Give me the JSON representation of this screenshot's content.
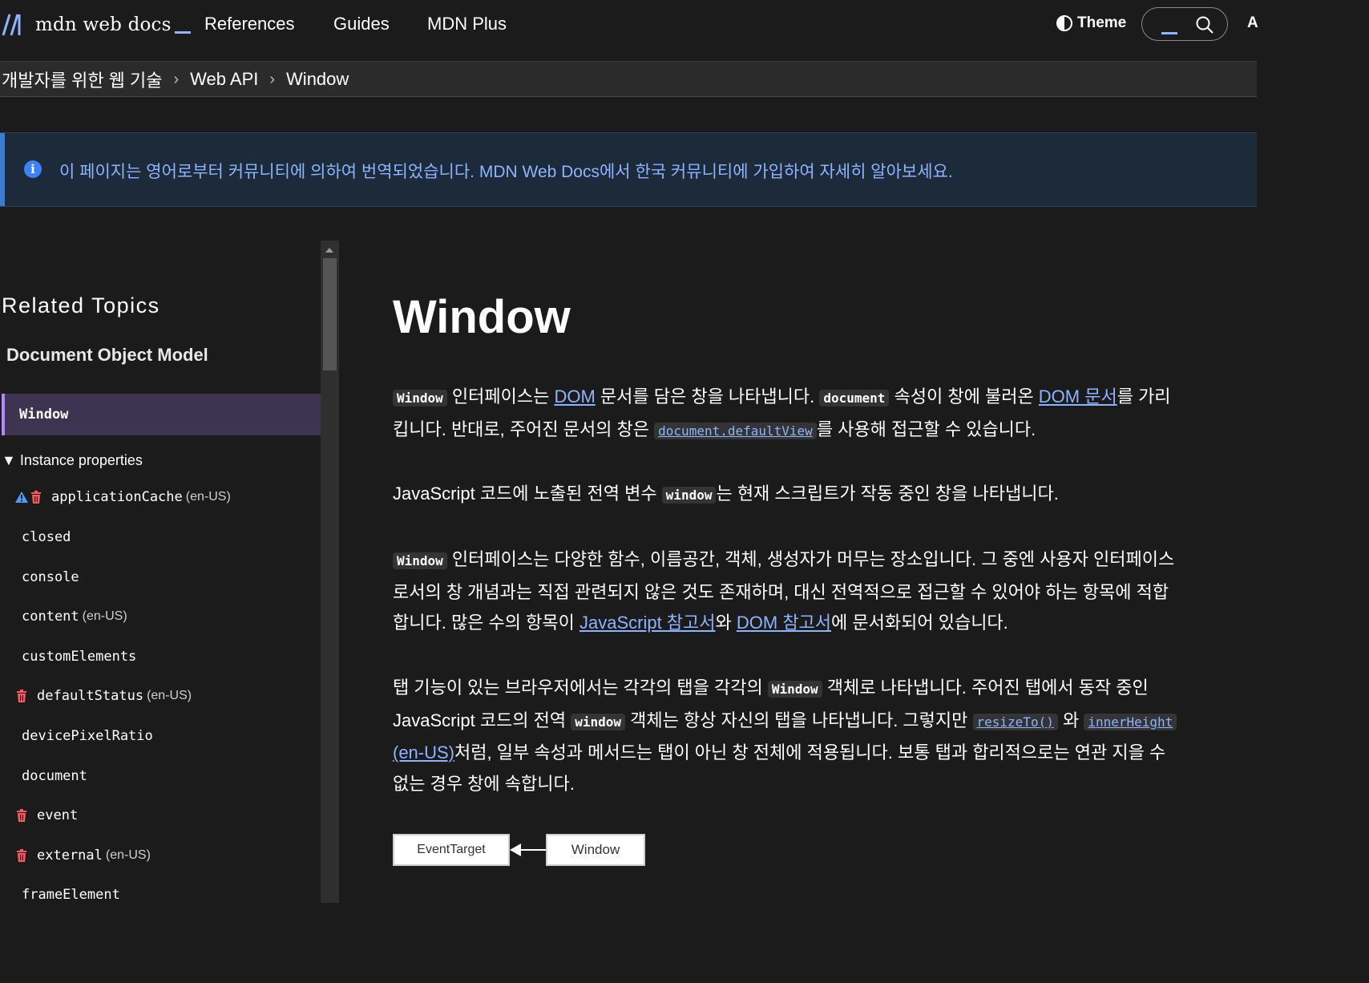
{
  "header": {
    "logo_text": "mdn web docs",
    "nav": [
      "References",
      "Guides",
      "MDN Plus"
    ],
    "theme_label": "Theme",
    "cut_text": "A"
  },
  "breadcrumb": [
    "개발자를 위한 웹 기술",
    "Web API",
    "Window"
  ],
  "notice": {
    "text": "이 페이지는 영어로부터 커뮤니티에 의하여 번역되었습니다. MDN Web Docs에서 한국 커뮤니티에 가입하여 자세히 알아보세요."
  },
  "sidebar": {
    "related_title": "Related Topics",
    "section_title": "Document Object Model",
    "active_item": "Window",
    "group_label": "Instance properties",
    "items": [
      {
        "name": "applicationCache",
        "lang": "(en-US)",
        "icons": [
          "warning",
          "trash"
        ]
      },
      {
        "name": "closed",
        "lang": "",
        "icons": []
      },
      {
        "name": "console",
        "lang": "",
        "icons": []
      },
      {
        "name": "content",
        "lang": "(en-US)",
        "icons": []
      },
      {
        "name": "customElements",
        "lang": "",
        "icons": []
      },
      {
        "name": "defaultStatus",
        "lang": "(en-US)",
        "icons": [
          "trash"
        ]
      },
      {
        "name": "devicePixelRatio",
        "lang": "",
        "icons": []
      },
      {
        "name": "document",
        "lang": "",
        "icons": []
      },
      {
        "name": "event",
        "lang": "",
        "icons": [
          "trash"
        ]
      },
      {
        "name": "external",
        "lang": "(en-US)",
        "icons": [
          "trash"
        ]
      },
      {
        "name": "frameElement",
        "lang": "",
        "icons": []
      }
    ]
  },
  "main": {
    "title": "Window",
    "p1": {
      "code1": "Window",
      "t1": " 인터페이스는 ",
      "link1": "DOM",
      "t2": " 문서를 담은 창을 나타냅니다. ",
      "code2": "document",
      "t3": " 속성이 창에 불러온 ",
      "link2": "DOM 문서",
      "t4": "를 가리",
      "t5": "킵니다. 반대로, 주어진 문서의 창은 ",
      "code3": "document.defaultView",
      "t6": "를 사용해 접근할 수 있습니다."
    },
    "p2": {
      "t1": "JavaScript 코드에 노출된 전역 변수 ",
      "code1": "window",
      "t2": "는 현재 스크립트가 작동 중인 창을 나타냅니다."
    },
    "p3": {
      "code1": "Window",
      "t1": " 인터페이스는 다양한 함수, 이름공간, 객체, 생성자가 머무는 장소입니다. 그 중엔 사용자 인터페이스",
      "t2": "로서의 창 개념과는 직접 관련되지 않은 것도 존재하며, 대신 전역적으로 접근할 수 있어야 하는 항목에 적합",
      "t3": "합니다. 많은 수의 항목이 ",
      "link1": "JavaScript 참고서",
      "t4": "와 ",
      "link2": "DOM 참고서",
      "t5": "에 문서화되어 있습니다."
    },
    "p4": {
      "t1": "탭 기능이 있는 브라우저에서는 각각의 탭을 각각의 ",
      "code1": "Window",
      "t2": " 객체로 나타냅니다. 주어진 탭에서 동작 중인",
      "t3": "JavaScript 코드의 전역 ",
      "code2": "window",
      "t4": " 객체는 항상 자신의 탭을 나타냅니다. 그렇지만 ",
      "code3": "resizeTo()",
      "t5": " 와 ",
      "code4": "innerHeight",
      "link1": "(en-US)",
      "t6": "처럼, 일부 속성과 메서드는 탭이 아닌 창 전체에 적용됩니다. 보통 탭과 합리적으로는 연관 지을 수",
      "t7": "없는 경우 창에 속합니다."
    },
    "diagram": {
      "parent": "EventTarget",
      "child": "Window"
    }
  },
  "colors": {
    "background": "#1b1b1b",
    "link": "#8cb4ff",
    "notice_bg": "#1c2a3a",
    "active_item_bg": "#3d3452"
  }
}
